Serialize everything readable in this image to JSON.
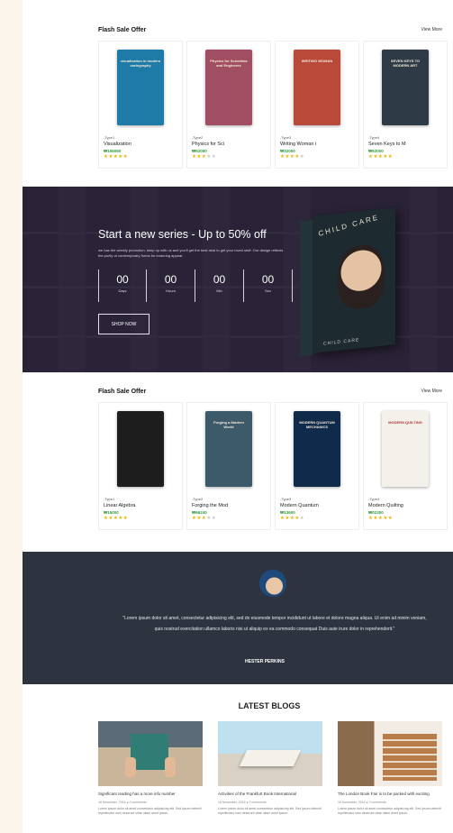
{
  "flash1": {
    "title": "Flash Sale Offer",
    "view_more": "View More",
    "items": [
      {
        "type": "-Type1",
        "name": "Visualization",
        "price": "₩156060",
        "rating": 5,
        "cover_title": "visualization in modern cartography",
        "cover_color": "#1e7aa6"
      },
      {
        "type": "-Type2",
        "name": "Physics for Sci",
        "price": "₩52000",
        "rating": 3,
        "cover_title": "Physics for Scientists and Engineers",
        "cover_color": "#a24e62"
      },
      {
        "type": "-Type3",
        "name": "Writing Woman i",
        "price": "₩32000",
        "rating": 4,
        "cover_title": "WRITING WOMAN",
        "cover_color": "#b94a3a"
      },
      {
        "type": "-Type4",
        "name": "Seven Keys to M",
        "price": "₩53000",
        "rating": 5,
        "cover_title": "SEVEN KEYS TO MODERN ART",
        "cover_color": "#2f3a47"
      }
    ]
  },
  "hero": {
    "title": "Start a new series - Up to 50% off",
    "desc": "we has the weekly promotion. keep up with us and you'll get the best deal to get your loved stuff. Our design reflects the purity of contemporary forms for enduring appeal.",
    "countdown": [
      {
        "num": "00",
        "label": "Days"
      },
      {
        "num": "00",
        "label": "Hours"
      },
      {
        "num": "00",
        "label": "Min"
      },
      {
        "num": "00",
        "label": "Sec"
      }
    ],
    "button": "SHOP NOW",
    "book_title": "CHILD CARE",
    "book_bottom": "CHILD CARE"
  },
  "flash2": {
    "title": "Flash Sale Offer",
    "view_more": "View More",
    "items": [
      {
        "type": "-Type1",
        "name": "Linear Algebra",
        "price": "₩15000",
        "rating": 5,
        "cover_title": "",
        "cover_color": "#1d1d1d"
      },
      {
        "type": "-Type2",
        "name": "Forging the Mod",
        "price": "₩66240",
        "rating": 3,
        "cover_title": "Forging a Modern World",
        "cover_color": "#3d5a6a"
      },
      {
        "type": "-Type3",
        "name": "Modern Quantum",
        "price": "₩13600",
        "rating": 4,
        "cover_title": "MODERN QUANTUM MECHANICS",
        "cover_color": "#0f2a4a"
      },
      {
        "type": "-Type4",
        "name": "Modern Quilting",
        "price": "₩02300",
        "rating": 5,
        "cover_title": "MODERN QUILTING",
        "cover_color": "#f4f0ea"
      }
    ]
  },
  "testimonial": {
    "quote": "\"Lorem ipsum dolor sit amet, consectetur adipisicing elit, sed do eiusmode tempor incididunt ut labore et dolore magna aliqua. Ut enim ad minim veniam, quis nostrud exercitation ullamco laboris nisi ut aliquip ex ea commodo consequat Duis aute irure dolor in reprehenderit.\"",
    "name": "HESTER PERKINS"
  },
  "blogs": {
    "title": "LATEST BLOGS",
    "items": [
      {
        "title": "Significant reading has a more info number",
        "meta": "16 November, 2016  ● 0 comments",
        "excerpt": "Lorem ipsum dolor sit amet consectetur adipisicing elit. Sed ipsum deleniti repellendus nam deserunt vitae ullam amet ipsum."
      },
      {
        "title": "Activities of the Frankfurt Book International",
        "meta": "16 November, 2016  ● 0 comments",
        "excerpt": "Lorem ipsum dolor sit amet consectetur adipisicing elit. Sed ipsum deleniti repellendus nam deserunt vitae ullam amet ipsum."
      },
      {
        "title": "The London Book Fair is to be packed with exciting",
        "meta": "16 November, 2016  ● 0 comments",
        "excerpt": "Lorem ipsum dolor sit amet consectetur adipisicing elit. Sed ipsum deleniti repellendus nam deserunt vitae ullam amet ipsum."
      }
    ]
  }
}
